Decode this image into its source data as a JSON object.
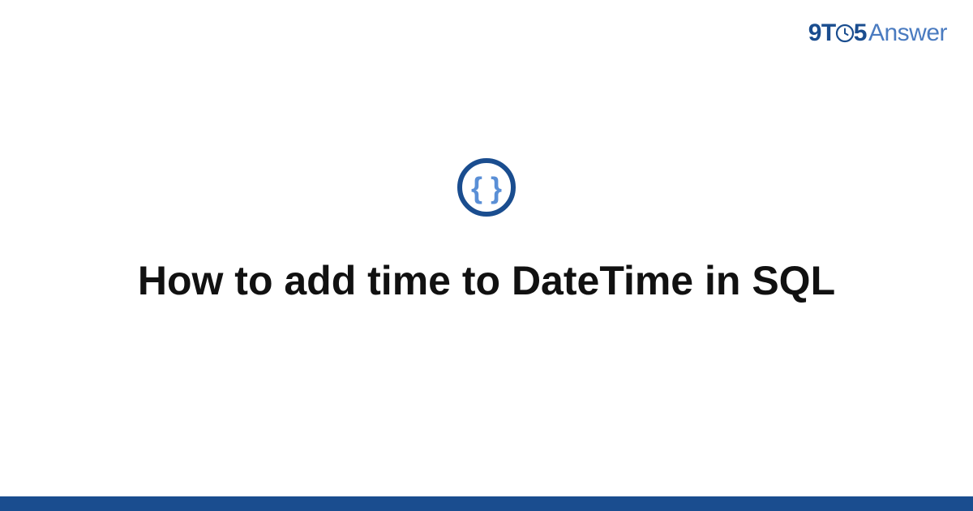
{
  "brand": {
    "prefix": "9T",
    "middle": "5",
    "suffix": "Answer"
  },
  "title": "How to add time to DateTime in SQL",
  "colors": {
    "brand_dark": "#1a4d8f",
    "brand_light": "#4a7bc0",
    "braces": "#5a8fd6"
  }
}
